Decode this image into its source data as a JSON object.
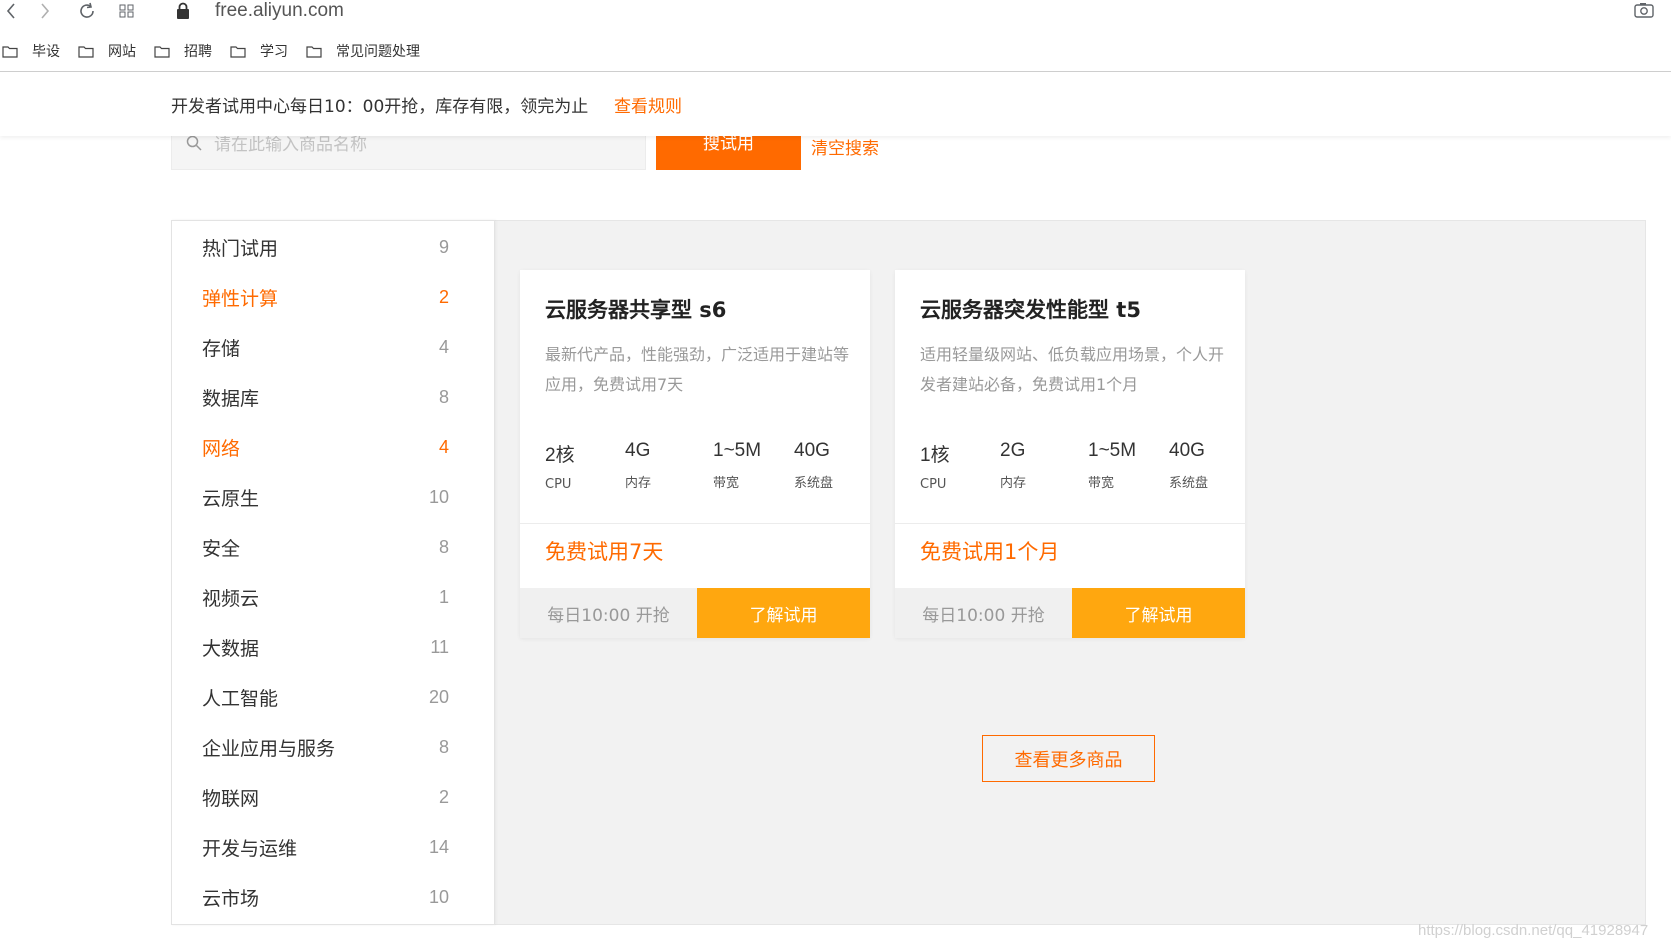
{
  "browser": {
    "url": "free.aliyun.com",
    "bookmarks": [
      {
        "label": "毕设"
      },
      {
        "label": "网站"
      },
      {
        "label": "招聘"
      },
      {
        "label": "学习"
      },
      {
        "label": "常见问题处理"
      }
    ]
  },
  "notice": {
    "text": "开发者试用中心每日10：00开抢，库存有限，领完为止",
    "link": "查看规则"
  },
  "search": {
    "placeholder": "请在此输入商品名称",
    "button": "搜试用",
    "clear": "清空搜索"
  },
  "categories": [
    {
      "label": "热门试用",
      "count": "9"
    },
    {
      "label": "弹性计算",
      "count": "2"
    },
    {
      "label": "存储",
      "count": "4"
    },
    {
      "label": "数据库",
      "count": "8"
    },
    {
      "label": "网络",
      "count": "4"
    },
    {
      "label": "云原生",
      "count": "10"
    },
    {
      "label": "安全",
      "count": "8"
    },
    {
      "label": "视频云",
      "count": "1"
    },
    {
      "label": "大数据",
      "count": "11"
    },
    {
      "label": "人工智能",
      "count": "20"
    },
    {
      "label": "企业应用与服务",
      "count": "8"
    },
    {
      "label": "物联网",
      "count": "2"
    },
    {
      "label": "开发与运维",
      "count": "14"
    },
    {
      "label": "云市场",
      "count": "10"
    }
  ],
  "products": [
    {
      "title": "云服务器共享型 s6",
      "desc": "最新代产品，性能强劲，广泛适用于建站等应用，免费试用7天",
      "specs": [
        {
          "value": "2核",
          "label": "CPU"
        },
        {
          "value": "4G",
          "label": "内存"
        },
        {
          "value": "1~5M",
          "label": "带宽"
        },
        {
          "value": "40G",
          "label": "系统盘"
        }
      ],
      "promo": "免费试用7天",
      "schedule": "每日10:00 开抢",
      "button": "了解试用"
    },
    {
      "title": "云服务器突发性能型 t5",
      "desc": "适用轻量级网站、低负载应用场景，个人开发者建站必备，免费试用1个月",
      "specs": [
        {
          "value": "1核",
          "label": "CPU"
        },
        {
          "value": "2G",
          "label": "内存"
        },
        {
          "value": "1~5M",
          "label": "带宽"
        },
        {
          "value": "40G",
          "label": "系统盘"
        }
      ],
      "promo": "免费试用1个月",
      "schedule": "每日10:00 开抢",
      "button": "了解试用"
    }
  ],
  "more_button": "查看更多商品",
  "watermark": "https://blog.csdn.net/qq_41928947",
  "colors": {
    "accent": "#ff6a00",
    "trial_button": "#ffa70f"
  }
}
